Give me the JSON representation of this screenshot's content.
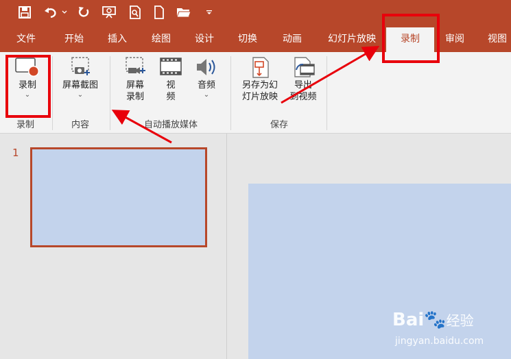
{
  "quick_access": {
    "icons": [
      "save-icon",
      "undo-icon",
      "undo-dropdown-icon",
      "redo-icon",
      "present-from-beginning-icon",
      "print-preview-icon",
      "new-file-icon",
      "open-folder-icon",
      "customize-toolbar-icon"
    ]
  },
  "menu": {
    "tabs": [
      "文件",
      "开始",
      "插入",
      "绘图",
      "设计",
      "切换",
      "动画",
      "幻灯片放映",
      "录制",
      "审阅",
      "视图"
    ],
    "active_tab": "录制"
  },
  "ribbon": {
    "groups": [
      {
        "label": "录制",
        "buttons": [
          {
            "label": "录制",
            "dropdown": true,
            "icon": "record-screen-icon"
          }
        ]
      },
      {
        "label": "内容",
        "buttons": [
          {
            "label": "屏幕截图",
            "dropdown": true,
            "icon": "screenshot-icon"
          }
        ]
      },
      {
        "label": "自动播放媒体",
        "buttons": [
          {
            "label_line1": "屏幕",
            "label_line2": "录制",
            "icon": "screen-recording-icon"
          },
          {
            "label_line1": "视",
            "label_line2": "频",
            "icon": "video-icon"
          },
          {
            "label": "音频",
            "dropdown": true,
            "icon": "audio-icon"
          }
        ]
      },
      {
        "label": "保存",
        "buttons": [
          {
            "label_line1": "另存为幻",
            "label_line2": "灯片放映",
            "icon": "save-as-show-icon"
          },
          {
            "label_line1": "导出",
            "label_line2": "到视频",
            "icon": "export-video-icon"
          }
        ]
      }
    ]
  },
  "thumbnails": {
    "slide_number": "1"
  },
  "colors": {
    "accent": "#b7472a",
    "highlight": "#e8000b",
    "slide": "#c3d3ec",
    "ribbon_bg": "#f3f3f3",
    "workspace": "#e6e6e6"
  },
  "watermark": {
    "brand_text": "Bai",
    "brand_suffix": "经验",
    "url": "jingyan.baidu.com"
  }
}
